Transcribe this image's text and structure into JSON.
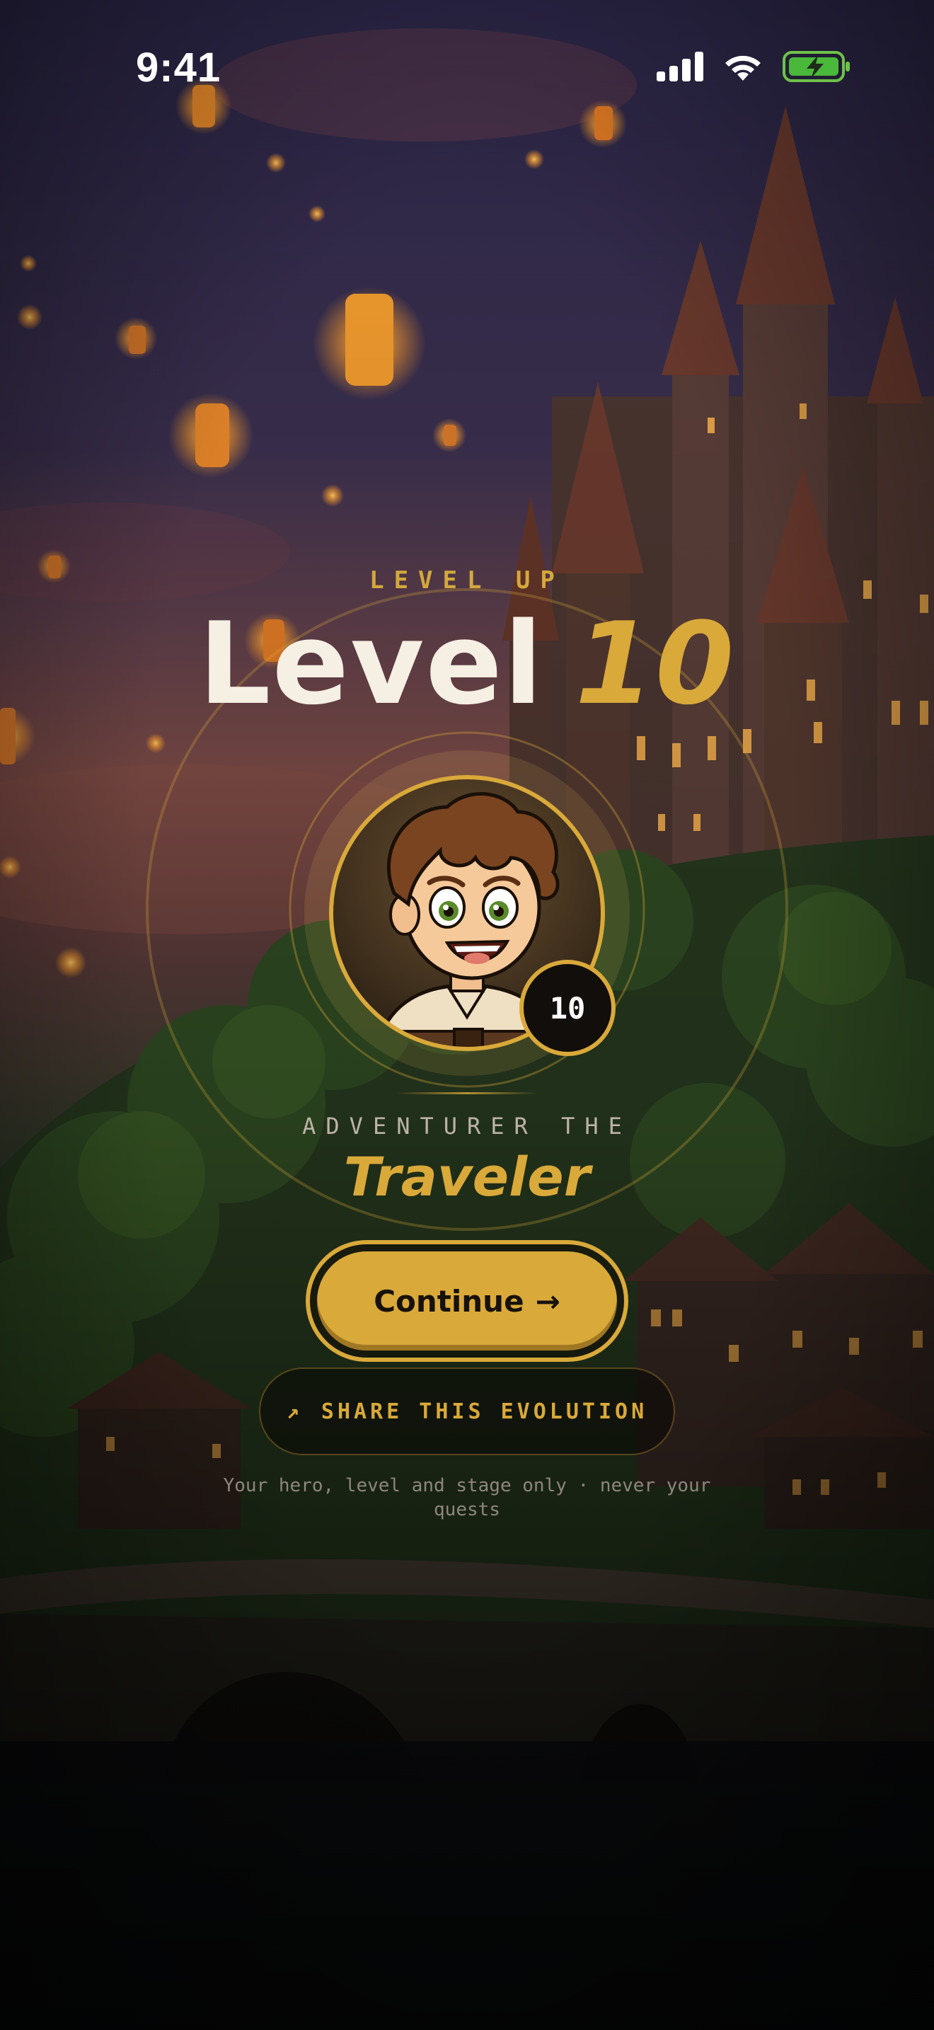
{
  "status_bar": {
    "time": "9:41"
  },
  "level_up": {
    "eyebrow": "LEVEL UP",
    "title_word": "Level",
    "level_number": "10"
  },
  "hero": {
    "badge_level": "10",
    "subtitle": "ADVENTURER THE",
    "class_name": "Traveler"
  },
  "actions": {
    "continue_label": "Continue",
    "continue_arrow": "→",
    "share_icon": "↗",
    "share_label": "SHARE THIS EVOLUTION"
  },
  "privacy_note": "Your hero, level and stage only · never your quests",
  "colors": {
    "accent": "#d9a93a",
    "badge_bg": "#120e0c",
    "title": "#f6efe3"
  },
  "icons": [
    "cellular-signal-icon",
    "wifi-icon",
    "battery-charging-icon",
    "arrow-right-icon",
    "share-arrow-icon"
  ]
}
